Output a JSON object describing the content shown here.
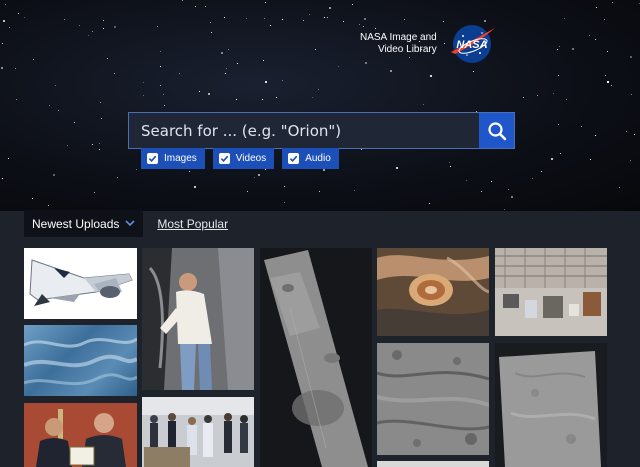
{
  "brand": {
    "line1": "NASA Image and",
    "line2": "Video Library",
    "logo_text": "NASA",
    "logo_icon": "nasa-meatball-logo"
  },
  "search": {
    "placeholder": "Search for ... (e.g. \"Orion\")",
    "value": "",
    "button_icon": "search-icon"
  },
  "filters": [
    {
      "label": "Images",
      "checked": true
    },
    {
      "label": "Videos",
      "checked": true
    },
    {
      "label": "Audio",
      "checked": true
    }
  ],
  "tabs": {
    "newest": "Newest Uploads",
    "popular": "Most Popular",
    "dropdown_icon": "chevron-down-icon"
  },
  "media": [
    {
      "name": "spaceplane-render-thumbnail"
    },
    {
      "name": "ocean-waves-aerial-thumbnail"
    },
    {
      "name": "award-ceremony-thumbnail"
    },
    {
      "name": "technician-spacecraft-thumbnail"
    },
    {
      "name": "press-event-thumbnail"
    },
    {
      "name": "mars-surface-strip-thumbnail"
    },
    {
      "name": "jupiter-storm-thumbnail"
    },
    {
      "name": "hangar-interior-thumbnail"
    },
    {
      "name": "cratered-terrain-thumbnail"
    },
    {
      "name": "grey-terrain-thumbnail"
    }
  ],
  "colors": {
    "accent": "#1d4fb8",
    "page_bg": "#1d222b"
  }
}
